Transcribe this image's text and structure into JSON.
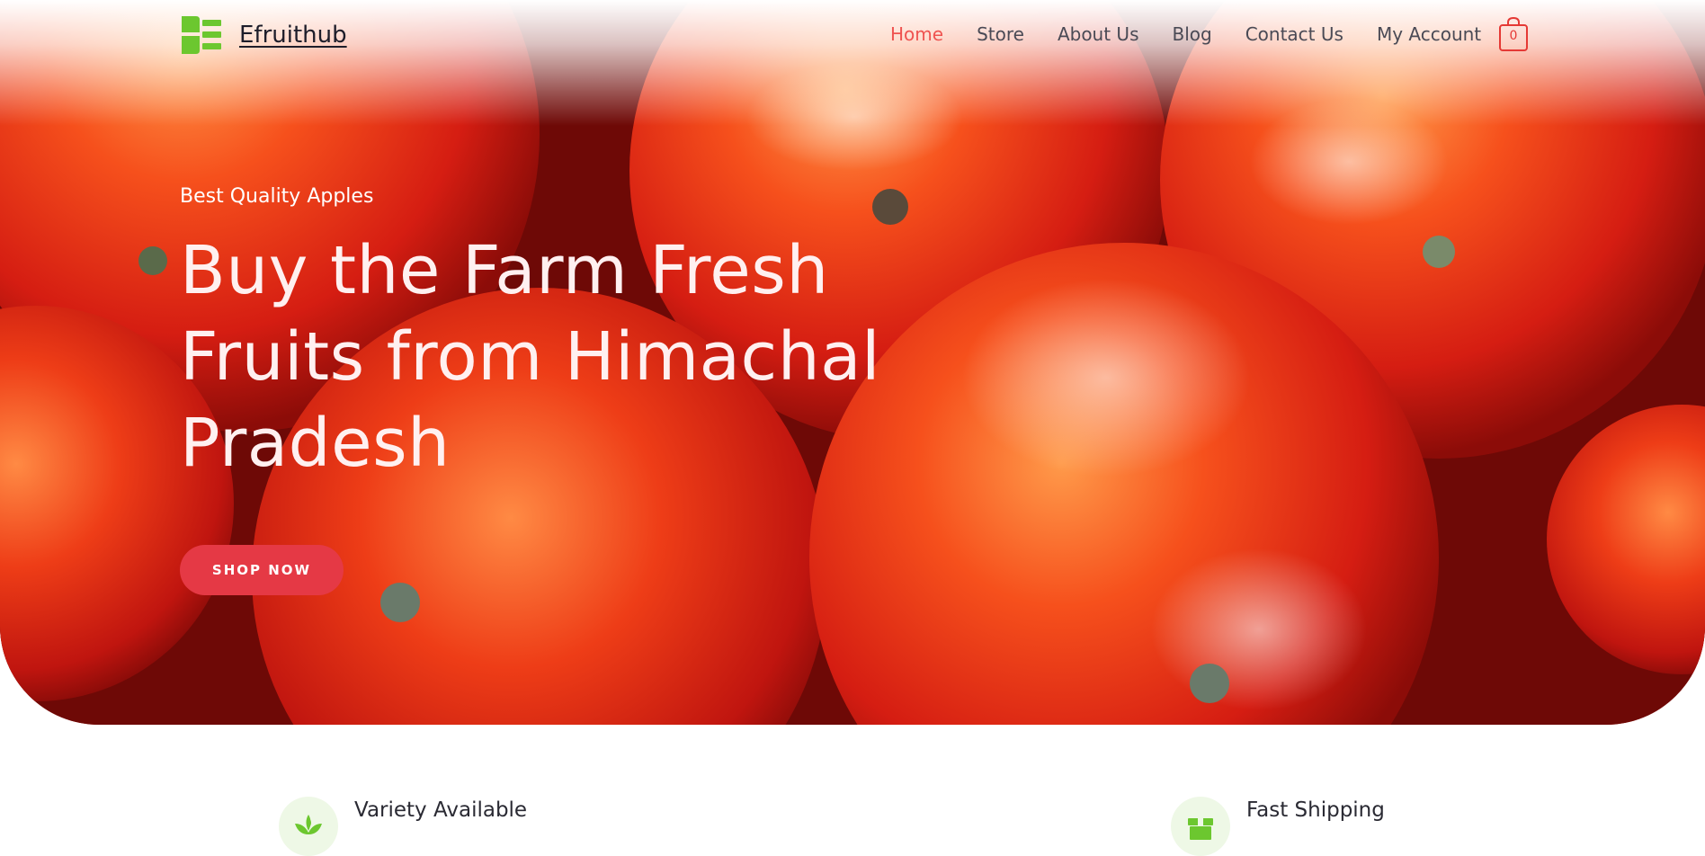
{
  "brand": {
    "name": "Efruithub"
  },
  "nav": {
    "items": [
      {
        "label": "Home",
        "active": true
      },
      {
        "label": "Store"
      },
      {
        "label": "About Us"
      },
      {
        "label": "Blog"
      },
      {
        "label": "Contact Us"
      },
      {
        "label": "My Account"
      }
    ],
    "cart_count": "0"
  },
  "hero": {
    "tagline": "Best Quality Apples",
    "headline": "Buy the Farm Fresh Fruits from Himachal Pradesh",
    "cta": "SHOP NOW"
  },
  "features": [
    {
      "title": "Variety Available",
      "icon": "leaf-icon"
    },
    {
      "title": "Fast Shipping",
      "icon": "box-icon"
    }
  ],
  "colors": {
    "accent": "#e53945",
    "nav_active": "#ef5350",
    "brand_green": "#6cc72f"
  }
}
